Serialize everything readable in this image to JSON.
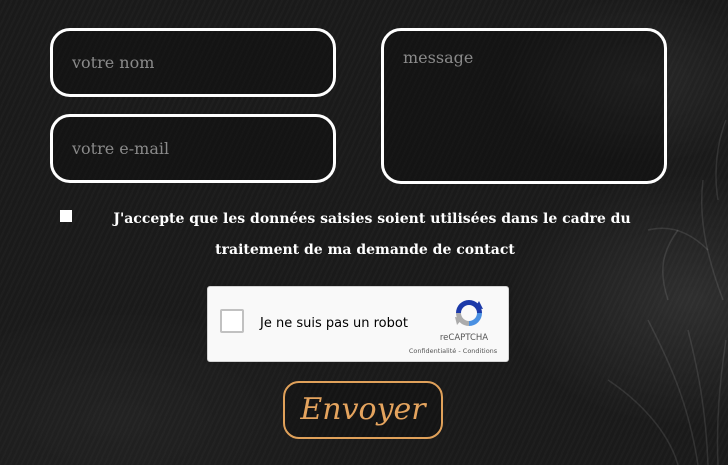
{
  "form": {
    "name_placeholder": "votre nom",
    "email_placeholder": "votre e-mail",
    "message_placeholder": "message",
    "name_value": "",
    "email_value": "",
    "message_value": ""
  },
  "consent": {
    "checked": false,
    "text": "J'accepte que les données saisies soient utilisées dans le cadre du traitement de ma demande de contact"
  },
  "recaptcha": {
    "label": "Je ne suis pas un robot",
    "brand": "reCAPTCHA",
    "privacy_link": "Confidentialité",
    "separator": " - ",
    "terms_link": "Conditions",
    "icon": "recaptcha-logo-icon"
  },
  "submit": {
    "label": "Envoyer"
  },
  "colors": {
    "background": "#1b1b1b",
    "field_border": "#ffffff",
    "placeholder": "#8a8a8a",
    "accent": "#e0a15a"
  }
}
